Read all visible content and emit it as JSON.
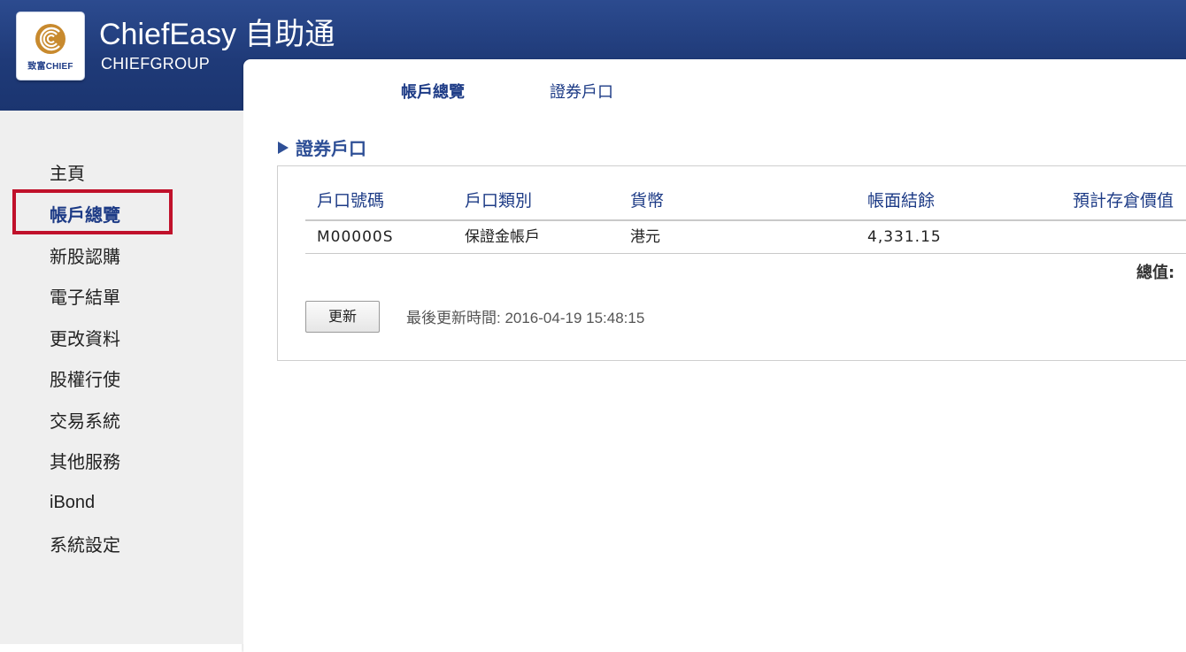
{
  "header": {
    "logo_text": "致富CHIEF",
    "title": "ChiefEasy 自助通",
    "subtitle": "CHIEFGROUP"
  },
  "sidebar": {
    "items": [
      {
        "label": "主頁"
      },
      {
        "label": "帳戶總覽",
        "active": true
      },
      {
        "label": "新股認購"
      },
      {
        "label": "電子結單"
      },
      {
        "label": "更改資料"
      },
      {
        "label": "股權行使"
      },
      {
        "label": "交易系統"
      },
      {
        "label": "其他服務"
      },
      {
        "label": "iBond"
      },
      {
        "label": "系統設定"
      }
    ]
  },
  "tabs": [
    {
      "label": "帳戶總覽",
      "active": true
    },
    {
      "label": "證券戶口",
      "active": false
    }
  ],
  "section": {
    "title": "證券戶口"
  },
  "table": {
    "columns": [
      "戶口號碼",
      "戶口類別",
      "貨幣",
      "帳面結餘",
      "預計存倉價值"
    ],
    "rows": [
      [
        "M00000S",
        "保證金帳戶",
        "港元",
        "4,331.15",
        ""
      ]
    ],
    "total_label": "總值:"
  },
  "refresh": {
    "button_label": "更新",
    "last_updated": "最後更新時間: 2016-04-19 15:48:15"
  },
  "colors": {
    "header_bg": "#1f3a78",
    "accent": "#1d3b86",
    "highlight": "#c0112b",
    "sidebar_bg": "#efefef"
  }
}
